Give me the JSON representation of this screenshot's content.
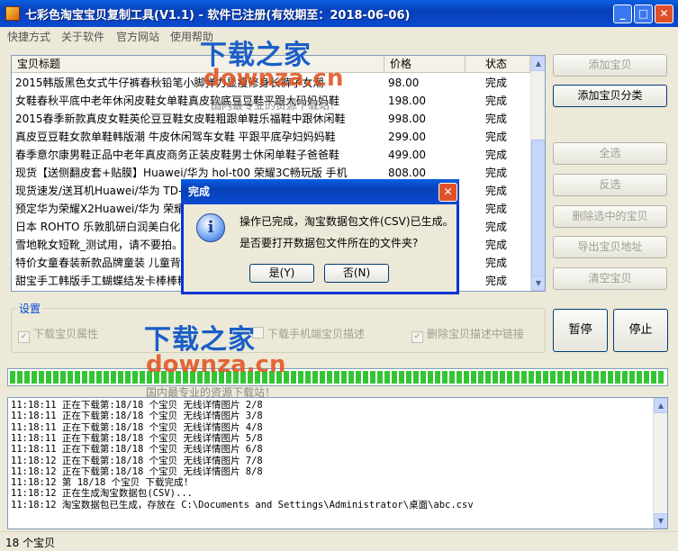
{
  "window": {
    "title": "七彩色淘宝宝贝复制工具(V1.1) - 软件已注册(有效期至：2018-06-06)",
    "minimize": "_",
    "maximize": "□",
    "close": "✕"
  },
  "menu": [
    "快捷方式",
    "关于软件",
    "官方网站",
    "使用帮助"
  ],
  "table": {
    "columns": [
      "宝贝标题",
      "价格",
      "状态"
    ],
    "rows": [
      {
        "title": "2015韩版黑色女式牛仔裤春秋铅笔小脚弹力显瘦修身长裤子女潮",
        "price": "98.00",
        "status": "完成"
      },
      {
        "title": "女鞋春秋平底中老年休闲皮鞋女单鞋真皮软底豆豆鞋平跟大码妈妈鞋",
        "price": "198.00",
        "status": "完成"
      },
      {
        "title": "2015春季新款真皮女鞋英伦豆豆鞋女皮鞋粗跟单鞋乐福鞋中跟休闲鞋",
        "price": "998.00",
        "status": "完成"
      },
      {
        "title": "真皮豆豆鞋女款单鞋韩版潮 牛皮休闲驾车女鞋 平跟平底孕妇妈妈鞋",
        "price": "299.00",
        "status": "完成"
      },
      {
        "title": "春季意尔康男鞋正品中老年真皮商务正装皮鞋男士休闲单鞋子爸爸鞋",
        "price": "499.00",
        "status": "完成"
      },
      {
        "title": "现货【送侧翻皮套+贴膜】Huawei/华为 hol-t00 荣耀3C畅玩版 手机",
        "price": "808.00",
        "status": "完成"
      },
      {
        "title": "现货速发/送耳机Huawei/华为 TD-S",
        "price": "",
        "status": "完成"
      },
      {
        "title": "预定华为荣耀X2Huawei/华为 荣耀X",
        "price": "",
        "status": "完成"
      },
      {
        "title": "日本 ROHTO 乐敦肌研白润美白化妆",
        "price": "",
        "status": "完成"
      },
      {
        "title": "雪地靴女短靴_测试用，请不要拍。",
        "price": "",
        "status": "完成"
      },
      {
        "title": "特价女童春装新款品牌童装 儿童背",
        "price": "",
        "status": "完成"
      },
      {
        "title": "甜宝手工韩版手工蝴蝶结发卡棒棒糖",
        "price": "",
        "status": "完成"
      }
    ]
  },
  "buttons": {
    "add_item": "添加宝贝",
    "add_category": "添加宝贝分类",
    "select_all": "全选",
    "invert": "反选",
    "delete_selected": "删除选中的宝贝",
    "export_urls": "导出宝贝地址",
    "clear_items": "清空宝贝",
    "pause": "暂停",
    "stop": "停止"
  },
  "settings": {
    "label": "设置",
    "options": [
      {
        "label": "下载宝贝属性",
        "checked": true
      },
      {
        "label": "下载手机端宝贝描述",
        "checked": false
      },
      {
        "label": "删除宝贝描述中链接",
        "checked": true
      }
    ]
  },
  "progress": {
    "value": 1.0
  },
  "log": [
    "11:18:11 正在下载第:18/18 个宝贝 无线详情图片 2/8",
    "11:18:11 正在下载第:18/18 个宝贝 无线详情图片 3/8",
    "11:18:11 正在下载第:18/18 个宝贝 无线详情图片 4/8",
    "11:18:11 正在下载第:18/18 个宝贝 无线详情图片 5/8",
    "11:18:11 正在下载第:18/18 个宝贝 无线详情图片 6/8",
    "11:18:12 正在下载第:18/18 个宝贝 无线详情图片 7/8",
    "11:18:12 正在下载第:18/18 个宝贝 无线详情图片 8/8",
    "11:18:12 第 18/18 个宝贝 下载完成!",
    "11:18:12 正在生成淘宝数据包(CSV)...",
    "11:18:12 淘宝数据包已生成，存放在 C:\\Documents and Settings\\Administrator\\桌面\\abc.csv"
  ],
  "status_bar": "18 个宝贝",
  "dialog": {
    "title": "完成",
    "icon": "info-icon",
    "message_line1": "操作已完成，淘宝数据包文件(CSV)已生成。",
    "message_line2": "是否要打开数据包文件所在的文件夹?",
    "yes": "是(Y)",
    "no": "否(N)",
    "close": "✕"
  },
  "watermark": {
    "brand": "下载之家",
    "url": "downza.cn",
    "slogan": "国内最专业的资源下载站！"
  }
}
